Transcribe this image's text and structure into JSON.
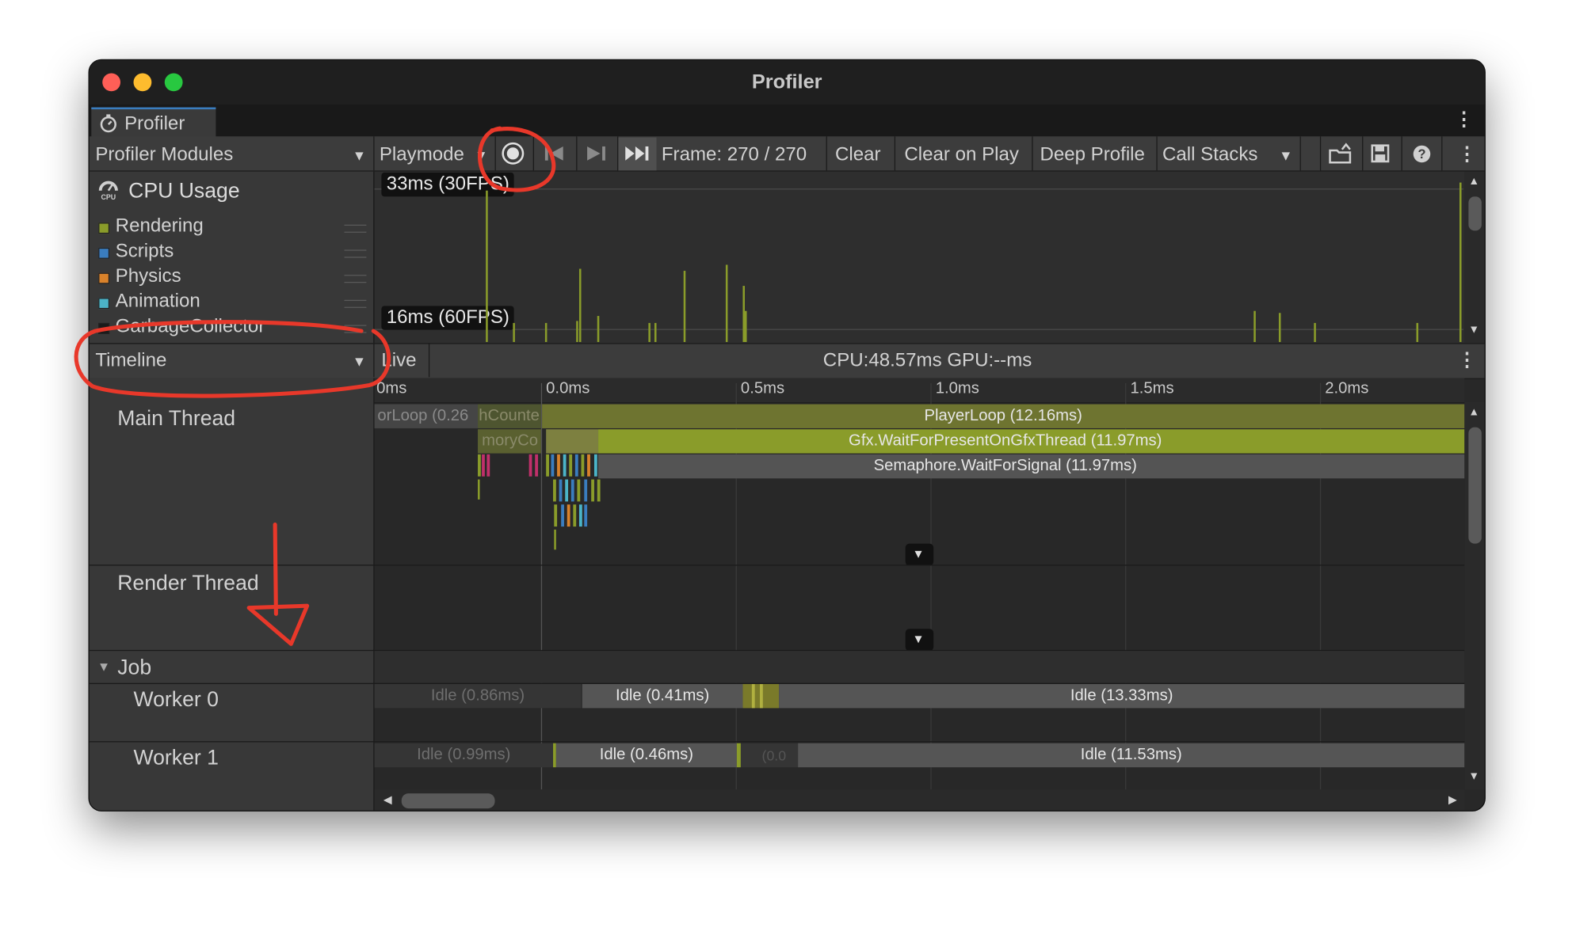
{
  "window": {
    "title": "Profiler"
  },
  "tab": {
    "label": "Profiler"
  },
  "toolbar": {
    "modules_dropdown": "Profiler Modules",
    "playmode_dropdown": "Playmode",
    "frame_label": "Frame: 270 / 270",
    "clear": "Clear",
    "clear_on_play": "Clear on Play",
    "deep_profile": "Deep Profile",
    "call_stacks": "Call Stacks"
  },
  "cpu_module": {
    "title": "CPU Usage",
    "legend": [
      {
        "label": "Rendering",
        "color": "#8a9c2a"
      },
      {
        "label": "Scripts",
        "color": "#3a7dbf"
      },
      {
        "label": "Physics",
        "color": "#d9822b"
      },
      {
        "label": "Animation",
        "color": "#4bb4c8"
      },
      {
        "label": "GarbageCollector",
        "color": "#1a1a1a"
      }
    ],
    "threshold_top": "33ms (30FPS)",
    "threshold_bottom": "16ms (60FPS)"
  },
  "timeline_bar": {
    "view_dropdown": "Timeline",
    "live": "Live",
    "cpu_gpu": "CPU:48.57ms   GPU:--ms"
  },
  "ruler": {
    "ticks": [
      "0ms",
      "0.0ms",
      "0.5ms",
      "1.0ms",
      "1.5ms",
      "2.0ms"
    ]
  },
  "threads": {
    "main": "Main Thread",
    "render": "Render Thread",
    "job_group": "Job",
    "worker0": "Worker 0",
    "worker1": "Worker 1"
  },
  "main_thread_bars": {
    "loop_partial": "orLoop (0.26",
    "counter_partial": "hCounte",
    "memory_partial": "moryCo",
    "player_loop": "PlayerLoop (12.16ms)",
    "gfx_wait": "Gfx.WaitForPresentOnGfxThread (11.97ms)",
    "semaphore": "Semaphore.WaitForSignal (11.97ms)"
  },
  "worker0_bars": {
    "idle_a": "Idle (0.86ms)",
    "idle_b": "Idle (0.41ms)",
    "idle_c": "Idle (13.33ms)"
  },
  "worker1_bars": {
    "idle_a": "Idle (0.99ms)",
    "idle_b": "Idle (0.46ms)",
    "idle_partial": "(0.0",
    "idle_c": "Idle (11.53ms)"
  },
  "colors": {
    "rendering": "#8a9c2a",
    "annotation": "#e8382a"
  }
}
